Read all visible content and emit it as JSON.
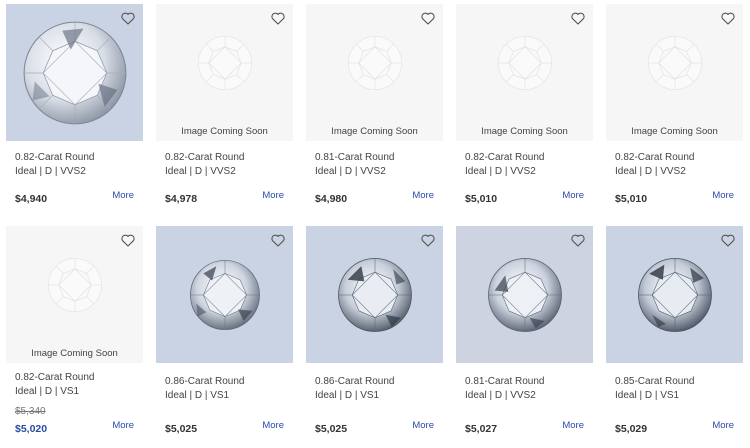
{
  "cards": [
    {
      "img": "photo-1",
      "soon": "",
      "title": "0.82-Carat Round",
      "spec": "Ideal | D | VVS2",
      "old_price": "",
      "price": "$4,940",
      "more": "More"
    },
    {
      "img": "placeholder",
      "soon": "Image Coming Soon",
      "title": "0.82-Carat Round",
      "spec": "Ideal | D | VVS2",
      "old_price": "",
      "price": "$4,978",
      "more": "More"
    },
    {
      "img": "placeholder",
      "soon": "Image Coming Soon",
      "title": "0.81-Carat Round",
      "spec": "Ideal | D | VVS2",
      "old_price": "",
      "price": "$4,980",
      "more": "More"
    },
    {
      "img": "placeholder",
      "soon": "Image Coming Soon",
      "title": "0.82-Carat Round",
      "spec": "Ideal | D | VVS2",
      "old_price": "",
      "price": "$5,010",
      "more": "More"
    },
    {
      "img": "placeholder",
      "soon": "Image Coming Soon",
      "title": "0.82-Carat Round",
      "spec": "Ideal | D | VVS2",
      "old_price": "",
      "price": "$5,010",
      "more": "More"
    },
    {
      "img": "placeholder",
      "soon": "Image Coming Soon",
      "title": "0.82-Carat Round",
      "spec": "Ideal | D | VS1",
      "old_price": "$5,340",
      "price": "$5,020",
      "more": "More"
    },
    {
      "img": "photo",
      "soon": "",
      "title": "0.86-Carat Round",
      "spec": "Ideal | D | VS1",
      "old_price": "",
      "price": "$5,025",
      "more": "More"
    },
    {
      "img": "photo",
      "soon": "",
      "title": "0.86-Carat Round",
      "spec": "Ideal | D | VS1",
      "old_price": "",
      "price": "$5,025",
      "more": "More"
    },
    {
      "img": "photo",
      "soon": "",
      "title": "0.81-Carat Round",
      "spec": "Ideal | D | VVS2",
      "old_price": "",
      "price": "$5,027",
      "more": "More"
    },
    {
      "img": "photo",
      "soon": "",
      "title": "0.85-Carat Round",
      "spec": "Ideal | D | VS1",
      "old_price": "",
      "price": "$5,029",
      "more": "More"
    }
  ],
  "colors": {
    "link": "#2b4aa8",
    "sale_price": "#2b4aa8",
    "photo_bg": "#c9d3e3",
    "placeholder_bg": "#f6f6f6"
  },
  "icons": {
    "favorite": "heart-outline-icon",
    "diamond": "round-diamond-icon"
  }
}
